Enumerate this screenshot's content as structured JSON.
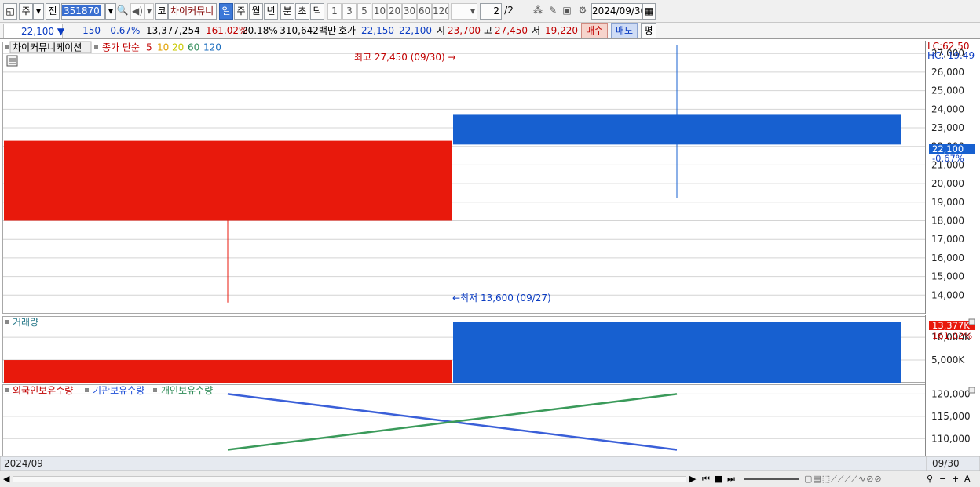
{
  "toolbar": {
    "market_label": "주",
    "prev_label": "전",
    "code": "351870",
    "kospi_label": "코",
    "stock_name": "차이커뮤니",
    "period_tabs": [
      "일",
      "주",
      "월",
      "년",
      "분",
      "초",
      "틱"
    ],
    "minute_tabs": [
      "1",
      "3",
      "5",
      "10",
      "20",
      "30",
      "60",
      "120"
    ],
    "page_value": "2",
    "page_total": "/2",
    "date_value": "2024/09/30"
  },
  "quote": {
    "price": "22,100",
    "change": "150",
    "change_pct": "-0.67%",
    "volume": "13,377,254",
    "vol_ratio": "161.02%",
    "turnover": "20.18%",
    "amount": "310,642백만",
    "hoga_label": "호가",
    "hoga_ask": "22,150",
    "hoga_bid": "22,100",
    "open_label": "시",
    "open_value": "23,700",
    "high_label": "고",
    "high_value": "27,450",
    "low_label": "저",
    "low_value": "19,220",
    "buy_label": "매수",
    "sell_label": "매도",
    "avg_label": "평"
  },
  "price_panel": {
    "name_tag": "차이커뮤니케이션",
    "ma_label": "종가 단순",
    "ma_periods": [
      "5",
      "10",
      "20",
      "60",
      "120"
    ],
    "ma_colors": [
      "#c00000",
      "#e0a000",
      "#c8c800",
      "#2e8b57",
      "#1e6fbf"
    ],
    "high_annotation": "최고 27,450 (09/30) →",
    "low_annotation": "←최저 13,600 (09/27)",
    "lc_label": "LC:62.50",
    "hc_label": "HC:-19.49",
    "cur_price_label": "22,100",
    "cur_change_label": "-0.67%"
  },
  "volume_panel": {
    "title": "거래량",
    "cur_label": "13,377K",
    "ratio_label": "161.02%"
  },
  "holdings_panel": {
    "legend": [
      "외국인보유수량",
      "기관보유수량",
      "개인보유수량"
    ],
    "legend_colors": [
      "#c00000",
      "#1e4fd8",
      "#2e8b57"
    ]
  },
  "axis": {
    "x_start_label": "2024/09",
    "x_end_label": "09/30"
  },
  "chart_data": [
    {
      "type": "candlestick",
      "categories": [
        "09/27",
        "09/30"
      ],
      "series": [
        {
          "open": 18000,
          "high": 18000,
          "low": 13600,
          "close": 22300,
          "color": "#e8190c"
        },
        {
          "open": 23700,
          "high": 27450,
          "low": 19220,
          "close": 22100,
          "color": "#1760d0"
        }
      ],
      "yticks": [
        14000,
        15000,
        16000,
        17000,
        18000,
        19000,
        20000,
        21000,
        22000,
        23000,
        24000,
        25000,
        26000,
        27000
      ],
      "ylim": [
        13000,
        27600
      ]
    },
    {
      "type": "bar",
      "categories": [
        "09/27",
        "09/30"
      ],
      "values": [
        5000,
        13377
      ],
      "colors": [
        "#e8190c",
        "#1760d0"
      ],
      "yticks": [
        5000,
        10000
      ],
      "ytick_labels": [
        "5,000K",
        "10,000K"
      ],
      "ylim": [
        0,
        14500
      ]
    },
    {
      "type": "line",
      "categories": [
        "09/27",
        "09/30"
      ],
      "series": [
        {
          "name": "기관보유수량",
          "values": [
            120000,
            107500
          ],
          "color": "#3a5fd8"
        },
        {
          "name": "개인보유수량",
          "values": [
            107500,
            120000
          ],
          "color": "#3a9a5a"
        }
      ],
      "yticks": [
        110000,
        115000,
        120000
      ],
      "ytick_labels": [
        "110,000",
        "115,000",
        "120,000"
      ],
      "ylim": [
        106000,
        122000
      ]
    }
  ]
}
